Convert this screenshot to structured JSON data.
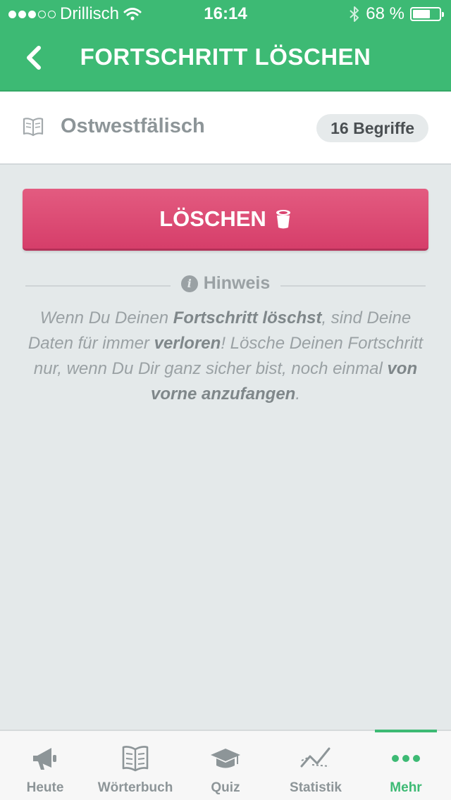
{
  "status_bar": {
    "carrier": "Drillisch",
    "time": "16:14",
    "battery_text": "68 %",
    "battery_level": 0.68,
    "signal_bars_filled": 3,
    "signal_bars_total": 5
  },
  "nav": {
    "title": "FORTSCHRITT LÖSCHEN",
    "back_icon": "chevron-left-icon"
  },
  "course": {
    "icon": "book-icon",
    "name": "Ostwestfälisch",
    "count_label": "16 Begriffe"
  },
  "delete_button": {
    "label": "LÖSCHEN",
    "icon": "trash-icon"
  },
  "hint": {
    "title": "Hinweis",
    "icon": "info-icon",
    "segments": [
      {
        "text": "Wenn Du Deinen ",
        "bold": false
      },
      {
        "text": "Fortschritt löschst",
        "bold": true
      },
      {
        "text": ", sind Deine Daten für immer ",
        "bold": false
      },
      {
        "text": "verloren",
        "bold": true
      },
      {
        "text": "! Lösche Deinen Fortschritt nur, wenn Du Dir ganz sicher bist, noch einmal ",
        "bold": false
      },
      {
        "text": "von vorne anzufangen",
        "bold": true
      },
      {
        "text": ".",
        "bold": false
      }
    ]
  },
  "tabs": [
    {
      "label": "Heute",
      "icon": "megaphone-icon",
      "active": false
    },
    {
      "label": "Wörterbuch",
      "icon": "book-icon",
      "active": false
    },
    {
      "label": "Quiz",
      "icon": "graduation-cap-icon",
      "active": false
    },
    {
      "label": "Statistik",
      "icon": "chart-icon",
      "active": false
    },
    {
      "label": "Mehr",
      "icon": "more-dots-icon",
      "active": true
    }
  ],
  "colors": {
    "brand_green": "#3dba74",
    "delete_pink": "#d94570",
    "background": "#e4e9ea"
  }
}
